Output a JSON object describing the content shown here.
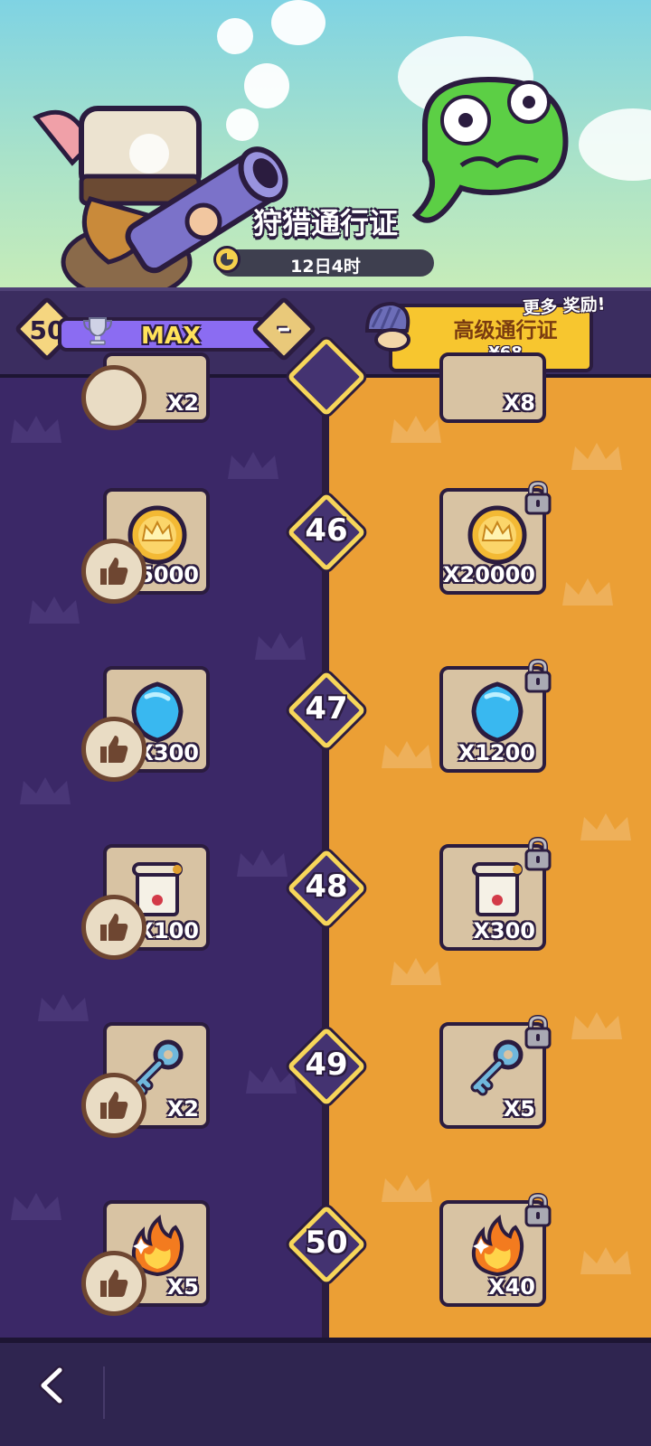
{
  "header": {
    "title": "狩猎通行证",
    "timer": "12日4时"
  },
  "level_bar": {
    "level": "50",
    "progress_label": "MAX",
    "progress_fraction": 1.0,
    "minus_label": "–"
  },
  "premium": {
    "title": "高级通行证",
    "price": "¥68",
    "more_rewards": "更多 奖励!"
  },
  "partial_row": {
    "free_qty": "X2",
    "premium_qty": "X8"
  },
  "rows": [
    {
      "level": "46",
      "item_icon": "coin-crown-icon",
      "free_qty": "5000",
      "premium_qty": "X20000"
    },
    {
      "level": "47",
      "item_icon": "blue-gem-icon",
      "free_qty": "X300",
      "premium_qty": "X1200"
    },
    {
      "level": "48",
      "item_icon": "scroll-icon",
      "free_qty": "X100",
      "premium_qty": "X300"
    },
    {
      "level": "49",
      "item_icon": "key-icon",
      "free_qty": "X2",
      "premium_qty": "X5"
    },
    {
      "level": "50",
      "item_icon": "flame-icon",
      "free_qty": "X5",
      "premium_qty": "X40"
    }
  ],
  "colors": {
    "free_track": "#3b2867",
    "premium_track": "#eb9f35",
    "premium_button": "#f7c62f",
    "progress_fill": "#8b6cf2"
  }
}
